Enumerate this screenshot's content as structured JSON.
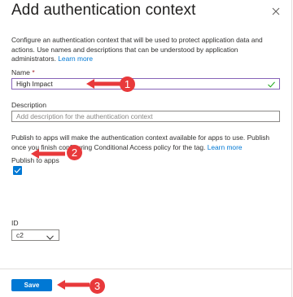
{
  "panel": {
    "title": "Add authentication context",
    "description": "Configure an authentication context that will be used to protect application data and actions. Use names and descriptions that can be understood by application administrators.",
    "learn_more": "Learn more"
  },
  "name": {
    "label": "Name",
    "required_marker": "*",
    "value": "High Impact"
  },
  "description_field": {
    "label": "Description",
    "placeholder": "Add description for the authentication context"
  },
  "publish": {
    "note": "Publish to apps will make the authentication context available for apps to use. Publish once you finish configuring Conditional Access policy for the tag.",
    "learn_more": "Learn more",
    "checkbox_label": "Publish to apps",
    "checked": true
  },
  "id_field": {
    "label": "ID",
    "selected": "c2"
  },
  "footer": {
    "save_label": "Save"
  },
  "annotations": [
    {
      "number": "1",
      "color": "#e8393b"
    },
    {
      "number": "2",
      "color": "#e8393b"
    },
    {
      "number": "3",
      "color": "#e8393b"
    }
  ],
  "colors": {
    "accent": "#0078d4",
    "name_border": "#8764b8",
    "check": "#13a10e",
    "annotation": "#e8393b"
  }
}
